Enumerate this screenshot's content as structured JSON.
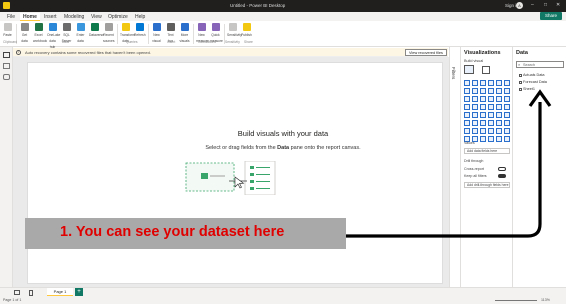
{
  "titlebar": {
    "title": "Untitled - Power BI Desktop",
    "signin": "Sign in",
    "avatar": "A"
  },
  "menu": {
    "tabs": [
      "File",
      "Home",
      "Insert",
      "Modeling",
      "View",
      "Optimize",
      "Help"
    ],
    "share": "Share"
  },
  "ribbon": {
    "buttons": [
      "Paste",
      "Get data",
      "Excel workbook",
      "OneLake data hub",
      "SQL Server",
      "Enter data",
      "Dataverse",
      "Recent sources",
      "Transform data",
      "Refresh",
      "New visual",
      "Text box",
      "More visuals",
      "New measure",
      "Quick measure",
      "Sensitivity",
      "Publish"
    ],
    "groups": [
      "Clipboard",
      "Data",
      "Queries",
      "Insert",
      "Calculations",
      "Sensitivity",
      "Share"
    ]
  },
  "warning": {
    "text": "Auto recovery contains some recovered files that haven't been opened.",
    "button": "View recovered files"
  },
  "canvas": {
    "heading": "Build visuals with your data",
    "sub_prefix": "Select or drag fields from the",
    "sub_bold": "Data",
    "sub_suffix": "pane onto the report canvas."
  },
  "filters": {
    "label": "Filters"
  },
  "viz": {
    "title": "Visualizations",
    "build": "Build visual",
    "values": "Values",
    "add_fields": "Add data fields here",
    "drill": "Drill through",
    "cross": "Cross-report",
    "keep": "Keep all filters",
    "add_drill": "Add drill-through fields here"
  },
  "data": {
    "title": "Data",
    "search": "Search",
    "tables": [
      "Actuals Data",
      "Forecast Data",
      "Sheet1"
    ]
  },
  "pages": {
    "page1": "Page 1",
    "add": "+"
  },
  "status": {
    "page": "Page 1 of 1",
    "zoom": "113%"
  },
  "callout": "1. You can see your dataset here"
}
